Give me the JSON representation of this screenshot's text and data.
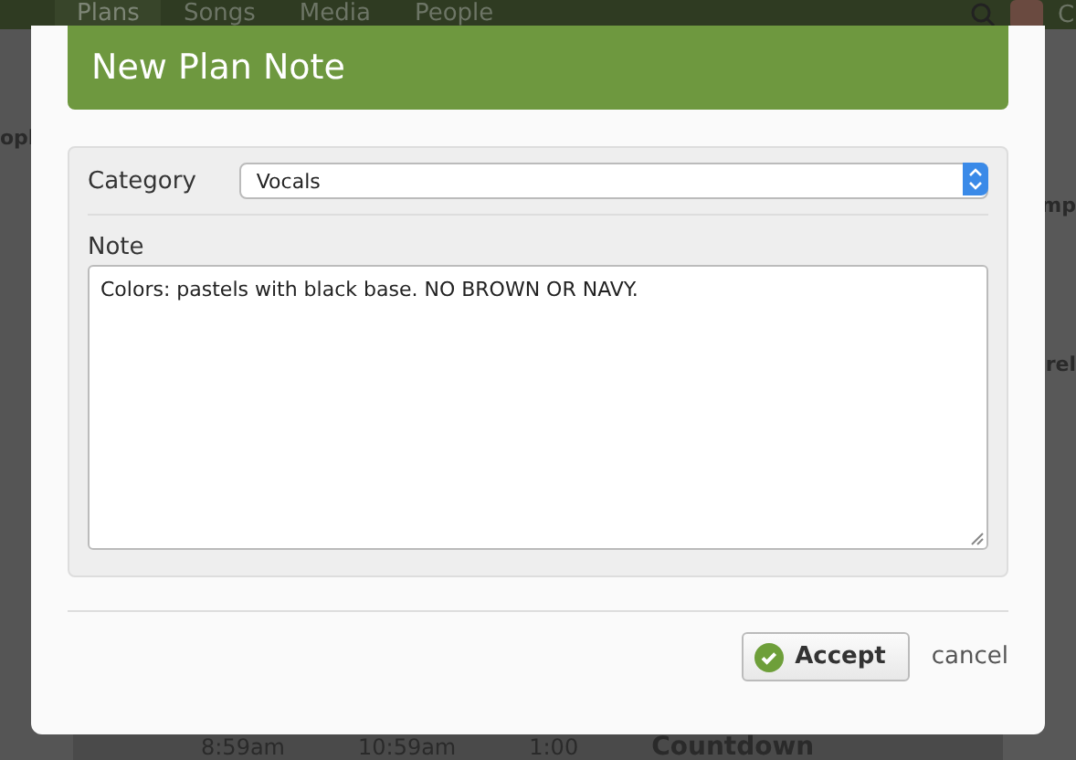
{
  "nav": {
    "items": [
      {
        "label": "Plans",
        "selected": true
      },
      {
        "label": "Songs",
        "selected": false
      },
      {
        "label": "Media",
        "selected": false
      },
      {
        "label": "People",
        "selected": false
      }
    ],
    "user_initial": "C"
  },
  "background": {
    "left_fragment": "opl",
    "right_fragments": [
      "mp",
      "rel"
    ],
    "row": {
      "start": "8:59am",
      "end": "10:59am",
      "length": "1:00",
      "title": "Countdown"
    }
  },
  "dialog": {
    "title": "New Plan Note",
    "category": {
      "label": "Category",
      "value": "Vocals"
    },
    "note": {
      "label": "Note",
      "value": "Colors: pastels with black base. NO BROWN OR NAVY."
    },
    "buttons": {
      "accept": "Accept",
      "cancel": "cancel"
    }
  }
}
